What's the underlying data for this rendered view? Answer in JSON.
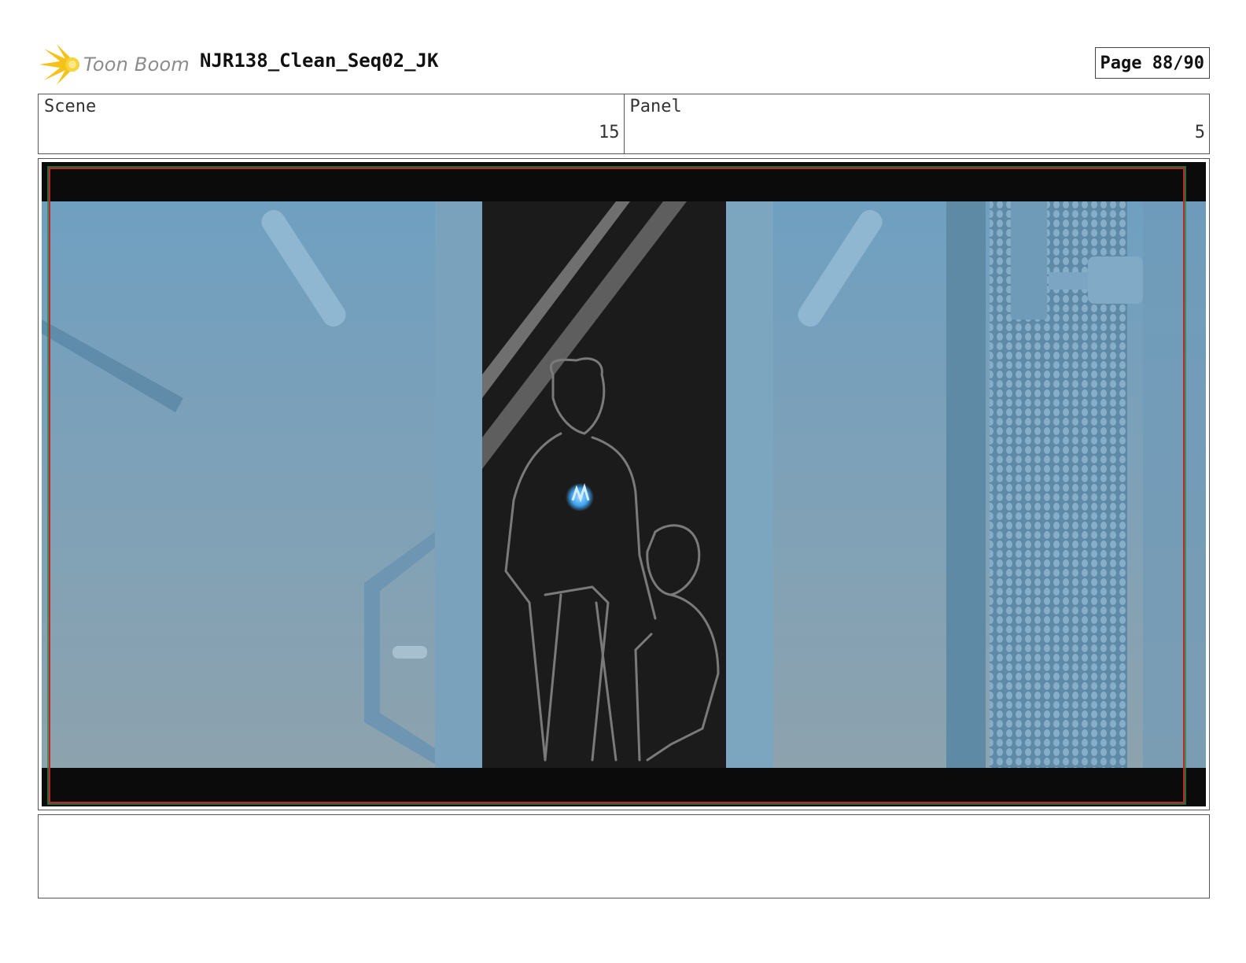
{
  "header": {
    "brand": "Toon Boom",
    "title": "NJR138_Clean_Seq02_JK",
    "page_label": "Page 88/90"
  },
  "info": {
    "scene_label": "Scene",
    "scene_value": "15",
    "panel_label": "Panel",
    "panel_value": "5"
  },
  "notes": {
    "text": ""
  },
  "colors": {
    "sky_top": "#6d9fc2",
    "sky_bottom": "#8fa3ad",
    "letterbox": "#0b0b0b",
    "safe_frame_red": "#c0262a",
    "safe_frame_green": "#2a8a4a",
    "doorway": "#1b1b1b",
    "sketch_line": "#7a7a7a",
    "glow": "#3da2f0"
  }
}
